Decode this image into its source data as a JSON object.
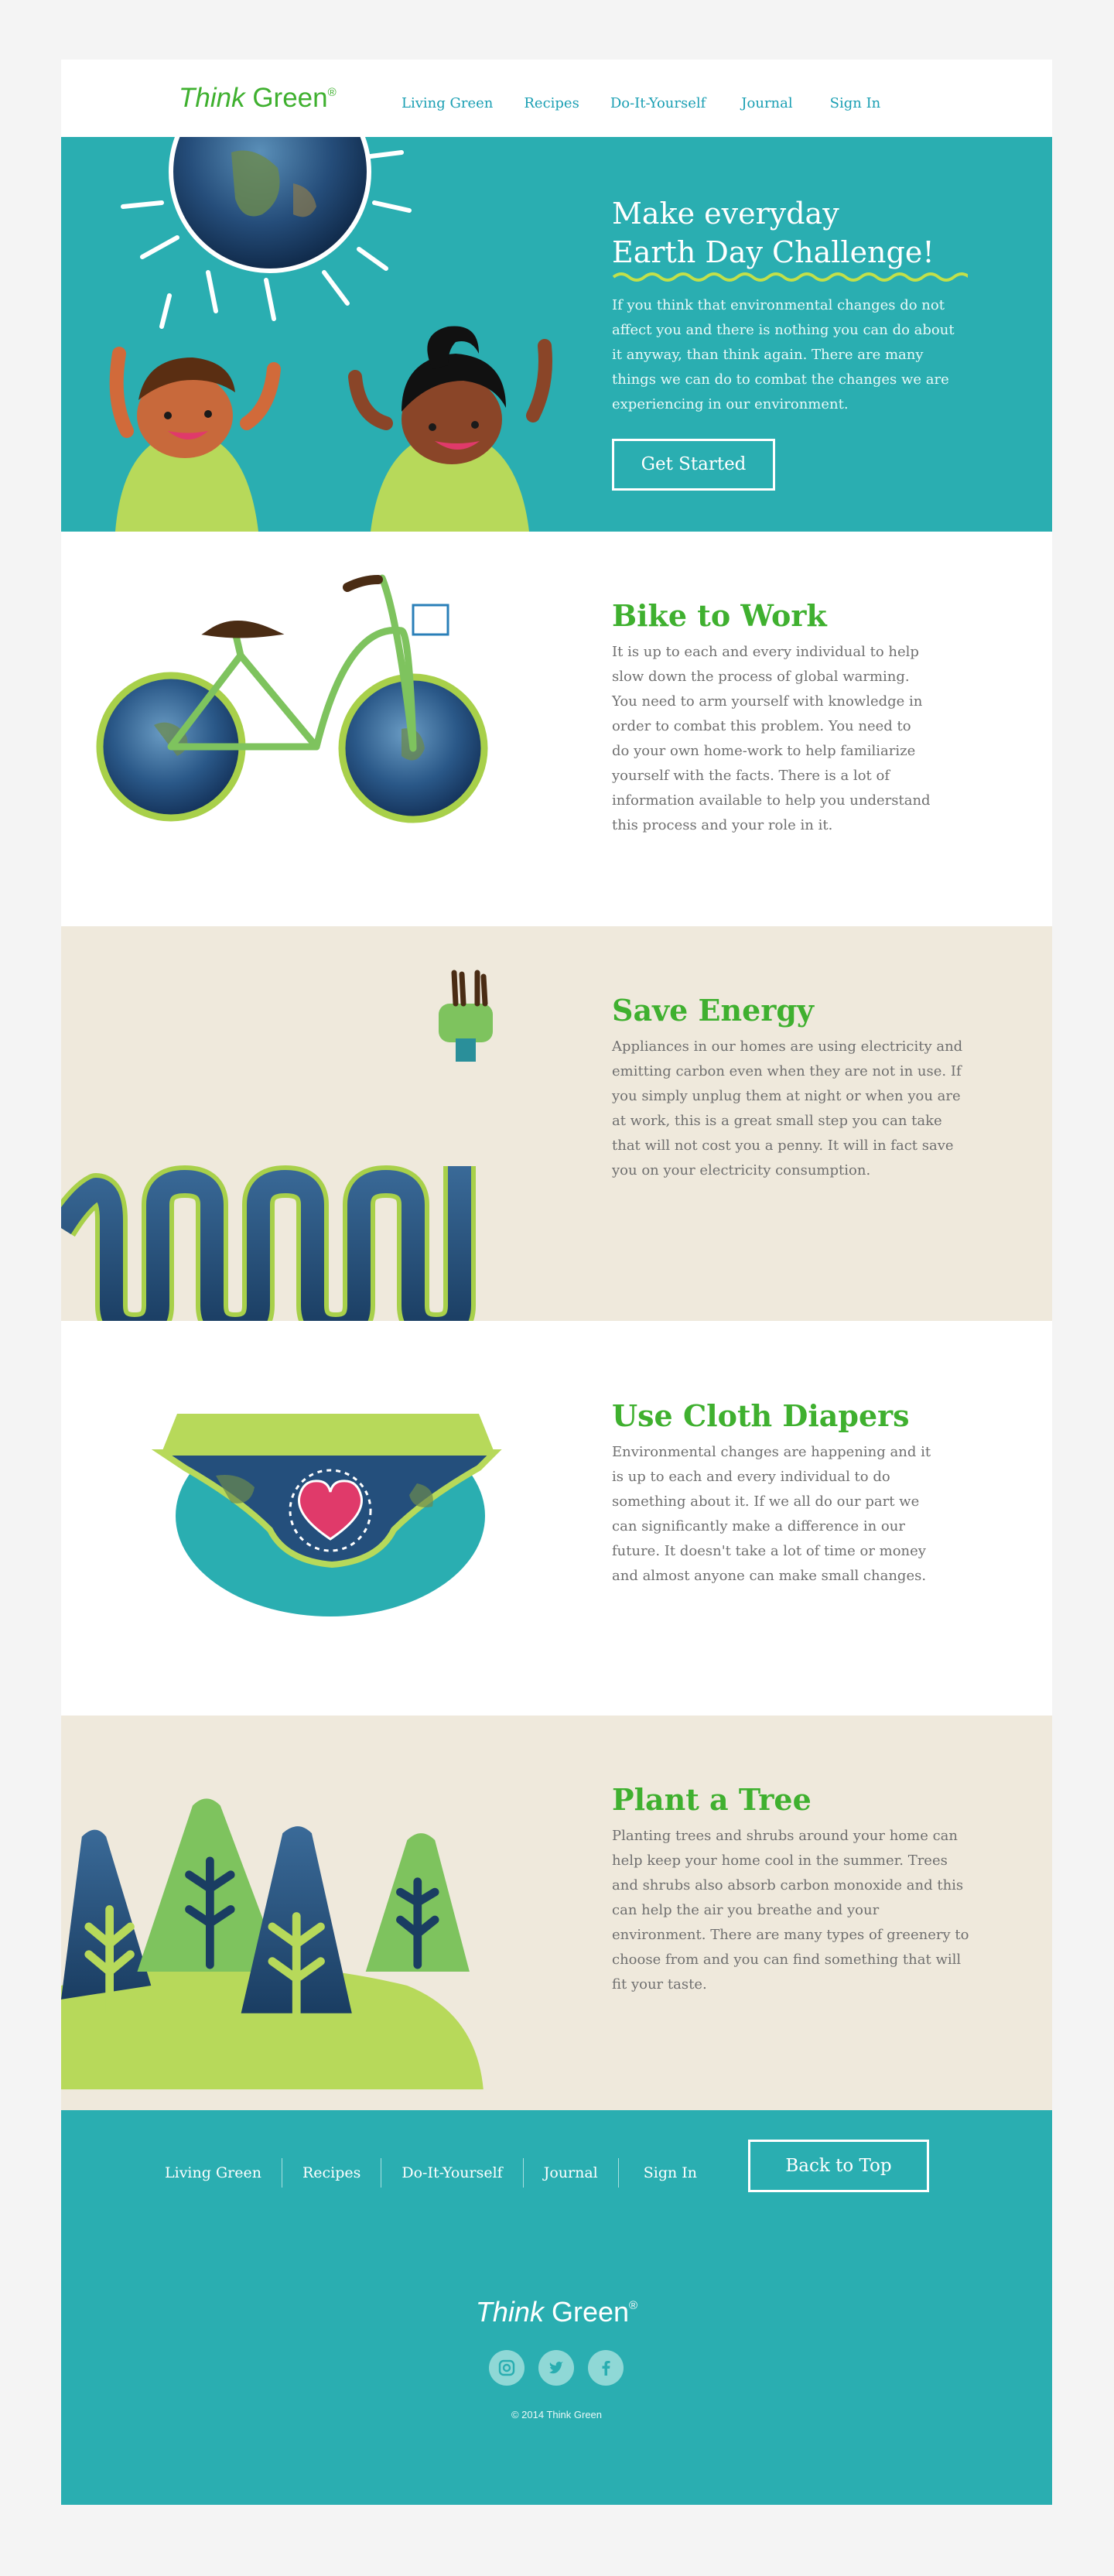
{
  "header": {
    "logo_italic": "Think",
    "logo_rest": " Green",
    "logo_mark": "®",
    "nav": [
      "Living Green",
      "Recipes",
      "Do-It-Yourself",
      "Journal",
      "Sign In"
    ]
  },
  "hero": {
    "title_line1": "Make everyday",
    "title_line2": "Earth Day Challenge!",
    "text": "If you think that environmental changes do not affect you and there is nothing you can do about it anyway, than think again. There are many things we can do to combat the changes we are experiencing in our environment.",
    "button": "Get Started"
  },
  "features": [
    {
      "title": "Bike to Work",
      "text": "It is up to each and every individual to help slow down the process of global warming. You need to arm yourself with knowledge in order to combat this problem. You need to do your own home-work to help familiarize yourself with the facts. There is a lot of information available to help you understand this process and your role in it."
    },
    {
      "title": "Save Energy",
      "text": "Appliances in our homes are using electricity and emitting carbon even when they are not in use. If you simply unplug them at night or when you are at work, this is a great small step you can take that will not cost you a penny. It will in fact save you on your electricity consumption."
    },
    {
      "title": "Use Cloth Diapers",
      "text": "Environmental changes are happening and it is up to each and every individual to do something about it. If we all do our part we can significantly make a difference in our future. It doesn't take a lot of time or money and almost anyone can make small changes."
    },
    {
      "title": "Plant a Tree",
      "text": "Planting trees and shrubs around your home can help keep your home cool in the summer. Trees and shrubs also absorb carbon monoxide and this can help the air you breathe and your environment. There are many types of greenery to choose from and you can find something that will fit your taste."
    }
  ],
  "footer": {
    "nav": [
      "Living Green",
      "Recipes",
      "Do-It-Yourself",
      "Journal",
      "Sign In"
    ],
    "back_to_top": "Back to Top",
    "logo_italic": "Think",
    "logo_rest": " Green",
    "logo_mark": "®",
    "social": [
      "instagram-icon",
      "twitter-icon",
      "facebook-icon"
    ],
    "copyright": "© 2014 Think Green"
  },
  "colors": {
    "brand_green": "#3fb02f",
    "teal": "#2aaeb1",
    "nav_link": "#1a9fb3",
    "paper": "#efe9dc"
  }
}
